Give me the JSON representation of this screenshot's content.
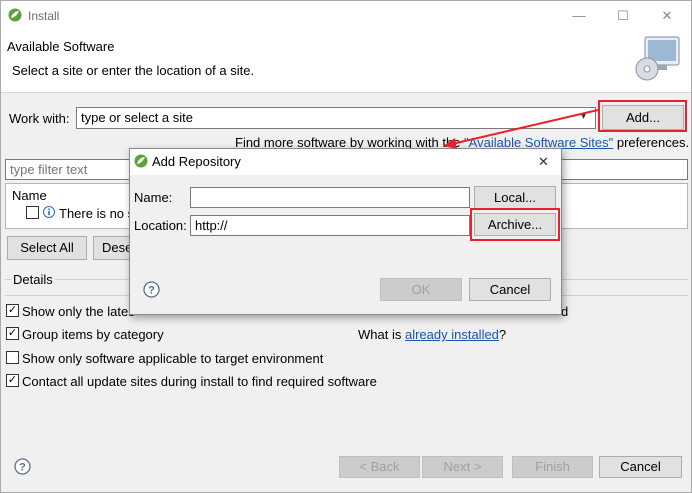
{
  "window": {
    "title": "Install",
    "minimize": "—",
    "maximize": "☐",
    "close": "✕"
  },
  "header": {
    "title": "Available Software",
    "subtitle": "Select a site or enter the location of a site."
  },
  "work_with": {
    "label": "Work with:",
    "value": "type or select a site",
    "add_button": "Add...",
    "find_more_prefix": "Find more software by working with the ",
    "find_more_link": "\"Available Software Sites\"",
    "find_more_suffix": " preferences."
  },
  "filter": {
    "placeholder": "type filter text"
  },
  "tree": {
    "column_name": "Name",
    "empty_text": "There is no s"
  },
  "buttons": {
    "select_all": "Select All",
    "deselect_all": "Dese"
  },
  "details": {
    "label": "Details"
  },
  "options": [
    {
      "label": "Show only the lates",
      "checked": "✓"
    },
    {
      "label": "Group items by category",
      "checked": "✓"
    },
    {
      "label": "Show only software applicable to target environment",
      "checked": ""
    },
    {
      "label": "Contact all update sites during install to find required software",
      "checked": "✓"
    }
  ],
  "installed": {
    "prefix": "What is ",
    "link": "already installed",
    "suffix": "?"
  },
  "partial_right_text": "d",
  "wizard_buttons": {
    "back": "< Back",
    "next": "Next >",
    "finish": "Finish",
    "cancel": "Cancel"
  },
  "add_repository": {
    "title": "Add Repository",
    "close": "✕",
    "name_label": "Name:",
    "name_value": "",
    "local_button": "Local...",
    "location_label": "Location:",
    "location_value": "http://",
    "archive_button": "Archive...",
    "ok_button": "OK",
    "cancel_button": "Cancel"
  },
  "colors": {
    "highlight": "#e8212a",
    "link": "#1a55b0",
    "eclipse_green": "#5aa33b"
  }
}
